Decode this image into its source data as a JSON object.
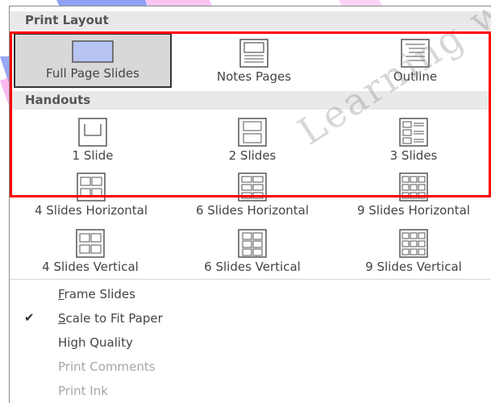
{
  "print_layout": {
    "header": "Print Layout",
    "options": [
      {
        "label": "Full Page Slides",
        "icon": "full-page-slide-icon",
        "selected": true
      },
      {
        "label": "Notes Pages",
        "icon": "notes-pages-icon",
        "selected": false
      },
      {
        "label": "Outline",
        "icon": "outline-icon",
        "selected": false
      }
    ]
  },
  "handouts": {
    "header": "Handouts",
    "options": [
      {
        "label": "1 Slide",
        "icon": "one-slide-icon"
      },
      {
        "label": "2 Slides",
        "icon": "two-slides-icon"
      },
      {
        "label": "3 Slides",
        "icon": "three-slides-icon"
      },
      {
        "label": "4 Slides Horizontal",
        "icon": "four-slides-horizontal-icon"
      },
      {
        "label": "6 Slides Horizontal",
        "icon": "six-slides-horizontal-icon"
      },
      {
        "label": "9 Slides Horizontal",
        "icon": "nine-slides-horizontal-icon"
      },
      {
        "label": "4 Slides Vertical",
        "icon": "four-slides-vertical-icon"
      },
      {
        "label": "6 Slides Vertical",
        "icon": "six-slides-vertical-icon"
      },
      {
        "label": "9 Slides Vertical",
        "icon": "nine-slides-vertical-icon"
      }
    ]
  },
  "menu": [
    {
      "label": "Frame Slides",
      "underline": "F",
      "rest": "rame Slides",
      "checked": false,
      "enabled": true
    },
    {
      "label": "Scale to Fit Paper",
      "underline": "S",
      "rest": "cale to Fit Paper",
      "checked": true,
      "enabled": true
    },
    {
      "label": "High Quality",
      "underline": "",
      "rest": "High Quality",
      "checked": false,
      "enabled": true
    },
    {
      "label": "Print Comments",
      "underline": "",
      "rest": "Print Comments",
      "checked": false,
      "enabled": false
    },
    {
      "label": "Print Ink",
      "underline": "",
      "rest": "Print Ink",
      "checked": false,
      "enabled": false
    }
  ],
  "check_glyph": "✔",
  "watermark": {
    "text": "Learning with",
    "colors": {
      "blue": "#6c82ee",
      "pink": "#f47fe4"
    }
  },
  "colors": {
    "highlight_box": "#ff0000",
    "selected_bg": "#d8d8d8",
    "header_bg": "#e9e9e9"
  }
}
